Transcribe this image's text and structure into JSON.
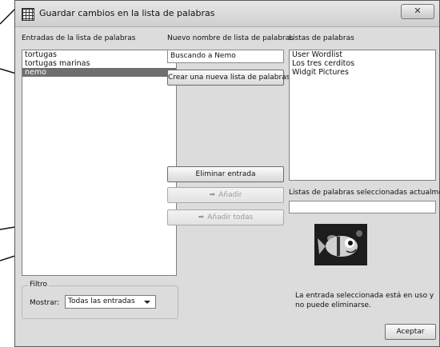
{
  "window": {
    "title": "Guardar cambios en la lista de palabras",
    "close_label": "✕"
  },
  "entries": {
    "label": "Entradas de la lista de palabras",
    "items": [
      {
        "text": "tortugas",
        "selected": false
      },
      {
        "text": "tortugas marinas",
        "selected": false
      },
      {
        "text": "nemo",
        "selected": true
      }
    ]
  },
  "new_list": {
    "label": "Nuevo nombre de lista de palabras",
    "value": "Buscando a Nemo",
    "create_button": "Crear una nueva lista de palabras"
  },
  "wordlists": {
    "label": "Listas de palabras",
    "items": [
      "User Wordlist",
      "Los tres cerditos",
      "Widgit Pictures"
    ]
  },
  "actions": {
    "delete_entry": "Eliminar entrada",
    "add": "Añadir",
    "add_all": "Añadir todas"
  },
  "selected_lists": {
    "label": "Listas de palabras seleccionadas actualmente",
    "value": ""
  },
  "filter": {
    "group_label": "Filtro",
    "show_label": "Mostrar:",
    "show_value": "Todas las entradas"
  },
  "message": "La entrada seleccionada está en uso y no puede eliminarse.",
  "accept_button": "Aceptar",
  "icons": {
    "title": "grid-icon",
    "close": "close-icon",
    "add_arrow": "arrow-right-icon",
    "combo": "chevron-down-icon"
  }
}
